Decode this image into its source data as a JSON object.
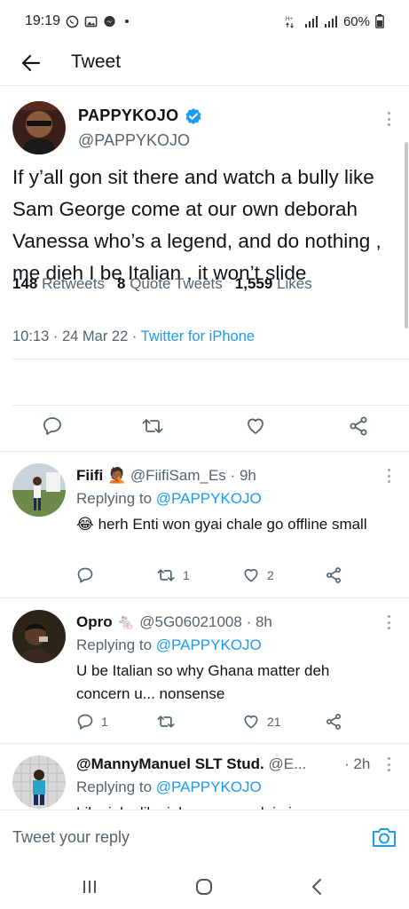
{
  "status": {
    "time": "19:19",
    "battery": "60%"
  },
  "app_bar": {
    "title": "Tweet"
  },
  "main_tweet": {
    "name": "PAPPYKOJO",
    "handle": "@PAPPYKOJO",
    "text": "If y’all gon sit there and watch a bully like Sam George come at our own deborah Vanessa who’s a legend, and do nothing , me dieh I be Italian , it won’t slide",
    "time": "10:13",
    "date": "24 Mar 22",
    "source": "Twitter for iPhone",
    "retweets_count": "148",
    "retweets_label": "Retweets",
    "quotes_count": "8",
    "quotes_label": "Quote Tweets",
    "likes_count": "1,559",
    "likes_label": "Likes"
  },
  "replies": [
    {
      "name": "Fiifi",
      "emoji": "🤦🏾",
      "handle": "@FiifiSam_Es",
      "age": "9h",
      "replying_label": "Replying to",
      "replying_to": "@PAPPYKOJO",
      "text": "😂 herh Enti won gyai chale go offline small",
      "retweets": "1",
      "likes": "2"
    },
    {
      "name": "Opro",
      "emoji": "🐁",
      "handle": "@5G06021008",
      "age": "8h",
      "replying_label": "Replying to",
      "replying_to": "@PAPPYKOJO",
      "text": "U be Italian so why Ghana matter deh concern u... nonsense",
      "replies": "1",
      "likes": "21"
    },
    {
      "name": "@MannyManuel SLT Stud.",
      "handle": "@E...",
      "age": "2h",
      "replying_label": "Replying to",
      "replying_to": "@PAPPYKOJO",
      "text": "Like joke like joke you are claiming"
    }
  ],
  "reply_bar": {
    "placeholder": "Tweet your reply"
  },
  "colors": {
    "accent": "#1d9bf0",
    "secondary_text": "#536471",
    "divider": "#e6ecf0"
  }
}
